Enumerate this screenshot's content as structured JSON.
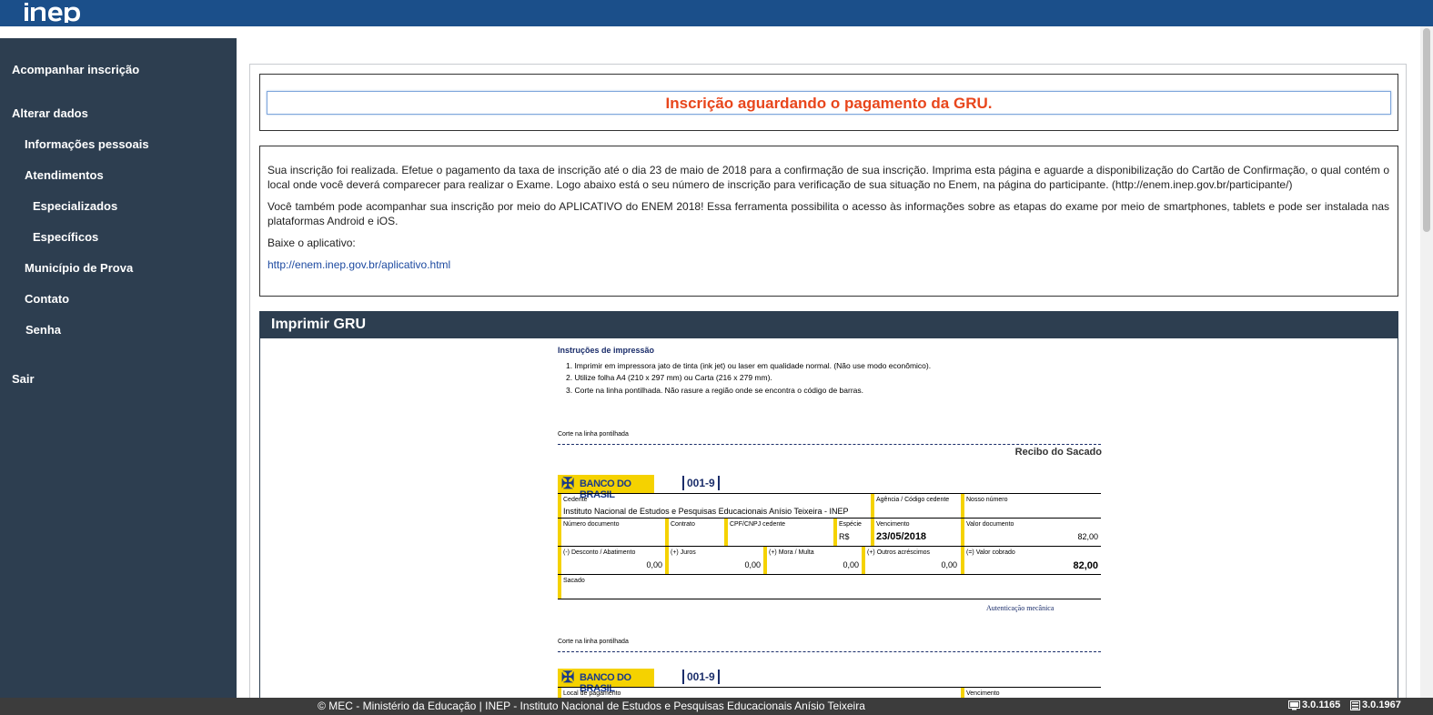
{
  "header": {
    "logo_text": "INEP"
  },
  "sidebar": {
    "items": [
      {
        "label": "Acompanhar inscrição"
      },
      {
        "label": "Alterar dados"
      },
      {
        "label": "Informações pessoais"
      },
      {
        "label": "Atendimentos"
      },
      {
        "label": "Especializados"
      },
      {
        "label": "Específicos"
      },
      {
        "label": "Município de Prova"
      },
      {
        "label": "Contato"
      },
      {
        "label": "Senha"
      },
      {
        "label": "Sair"
      }
    ]
  },
  "status": {
    "message": "Inscrição aguardando o pagamento da GRU."
  },
  "info": {
    "p1": "Sua inscrição foi realizada. Efetue o pagamento da taxa de inscrição até o dia 23 de maio de 2018 para a confirmação de sua inscrição. Imprima esta página e aguarde a disponibilização do Cartão de Confirmação, o qual contém o local onde você deverá comparecer para realizar o Exame. Logo abaixo está o seu número de inscrição para verificação de sua situação no Enem, na página do participante. (http://enem.inep.gov.br/participante/)",
    "p2": "Você também pode acompanhar sua inscrição por meio do APLICATIVO do ENEM 2018! Essa ferramenta possibilita o acesso às informações sobre as etapas do exame por meio de smartphones, tablets e pode ser instalada nas plataformas Android e iOS.",
    "p3": "Baixe o aplicativo:",
    "link": "http://enem.inep.gov.br/aplicativo.html"
  },
  "gru": {
    "title": "Imprimir GRU",
    "instructions_title": "Instruções de impressão",
    "instructions": [
      "1. Imprimir em impressora jato de tinta (ink jet) ou laser em qualidade normal. (Não use modo econômico).",
      "2. Utilize folha A4 (210 x 297 mm) ou Carta (216 x 279 mm).",
      "3. Corte na linha pontilhada. Não rasure a região onde se encontra o código de barras."
    ],
    "cut_label": "Corte na linha pontilhada",
    "receipt_title": "Recibo do Sacado",
    "bank_name": "BANCO DO BRASIL",
    "bank_code": "001-9",
    "labels": {
      "cedente": "Cedente",
      "agencia": "Agência / Código cedente",
      "nosso_numero": "Nosso número",
      "numero_documento": "Número documento",
      "contrato": "Contrato",
      "cpf_cnpj": "CPF/CNPJ cedente",
      "especie": "Espécie",
      "vencimento": "Vencimento",
      "valor_documento": "Valor documento",
      "desconto": "(-) Desconto / Abatimento",
      "juros": "(+) Juros",
      "mora": "(+) Mora / Multa",
      "outros": "(+) Outros acréscimos",
      "valor_cobrado": "(=) Valor cobrado",
      "sacado": "Sacado",
      "autenticacao": "Autenticação mecânica",
      "local_pagamento": "Local de pagamento"
    },
    "values": {
      "cedente": "Instituto Nacional de Estudos e Pesquisas Educacionais Anísio Teixeira - INEP",
      "especie": "R$",
      "vencimento": "23/05/2018",
      "valor_documento": "82,00",
      "desconto": "0,00",
      "juros": "0,00",
      "mora": "0,00",
      "outros": "0,00",
      "valor_cobrado": "82,00"
    }
  },
  "footer": {
    "text": "© MEC - Ministério da Educação | INEP - Instituto Nacional de Estudos e Pesquisas Educacionais Anísio Teixeira",
    "version1": "3.0.1165",
    "version2": "3.0.1967"
  }
}
